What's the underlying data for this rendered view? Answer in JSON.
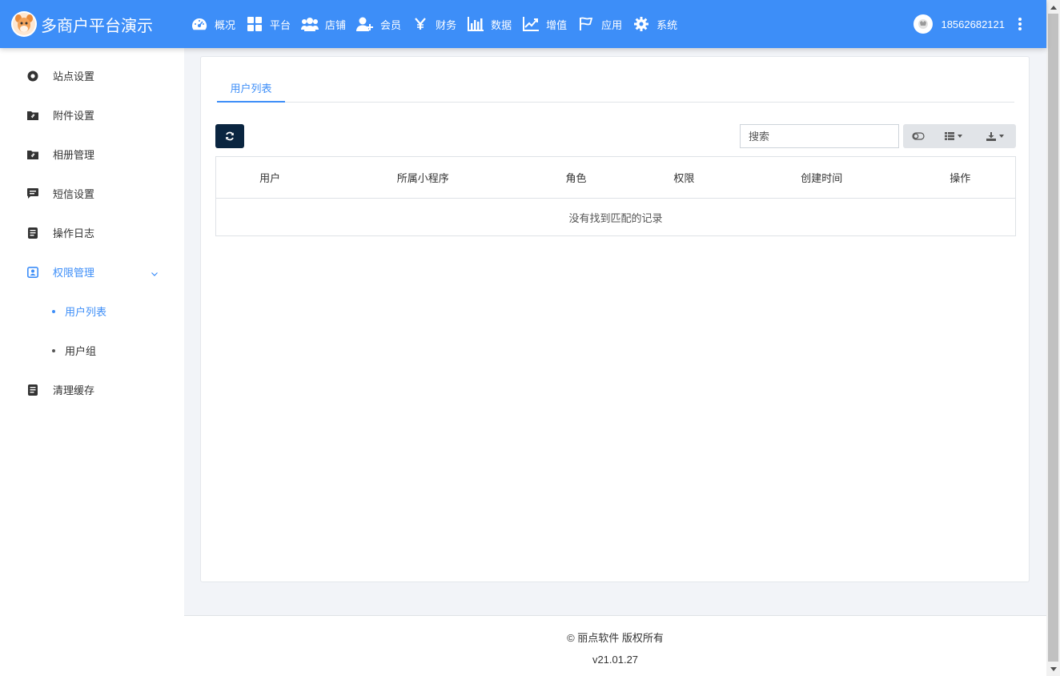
{
  "brand": {
    "title": "多商户平台演示"
  },
  "nav": [
    {
      "label": "概况",
      "icon": "dashboard-icon"
    },
    {
      "label": "平台",
      "icon": "grid-icon"
    },
    {
      "label": "店铺",
      "icon": "users-icon"
    },
    {
      "label": "会员",
      "icon": "user-plus-icon"
    },
    {
      "label": "财务",
      "icon": "yen-icon"
    },
    {
      "label": "数据",
      "icon": "bar-chart-icon"
    },
    {
      "label": "增值",
      "icon": "line-chart-icon"
    },
    {
      "label": "应用",
      "icon": "flag-icon"
    },
    {
      "label": "系统",
      "icon": "gear-icon"
    }
  ],
  "user": {
    "phone": "18562682121"
  },
  "sidebar": {
    "items": [
      {
        "label": "站点设置",
        "icon": "settings-circle-icon"
      },
      {
        "label": "附件设置",
        "icon": "folder-clip-icon"
      },
      {
        "label": "相册管理",
        "icon": "folder-clip-icon"
      },
      {
        "label": "短信设置",
        "icon": "message-icon"
      },
      {
        "label": "操作日志",
        "icon": "document-icon"
      },
      {
        "label": "权限管理",
        "icon": "user-badge-icon",
        "active": true,
        "expanded": true
      },
      {
        "label": "清理缓存",
        "icon": "document-icon"
      }
    ],
    "subitems": [
      {
        "label": "用户列表",
        "active": true
      },
      {
        "label": "用户组",
        "active": false
      }
    ]
  },
  "main": {
    "tab": "用户列表",
    "search": {
      "placeholder": "搜索",
      "value": ""
    },
    "table": {
      "columns": [
        "用户",
        "所属小程序",
        "角色",
        "权限",
        "创建时间",
        "操作"
      ],
      "empty_text": "没有找到匹配的记录"
    }
  },
  "footer": {
    "copyright": "© 丽点软件 版权所有",
    "version": "v21.01.27"
  },
  "colors": {
    "primary": "#3d8ef8",
    "dark_button": "#0a2540",
    "page_bg": "#f2f4f8"
  }
}
